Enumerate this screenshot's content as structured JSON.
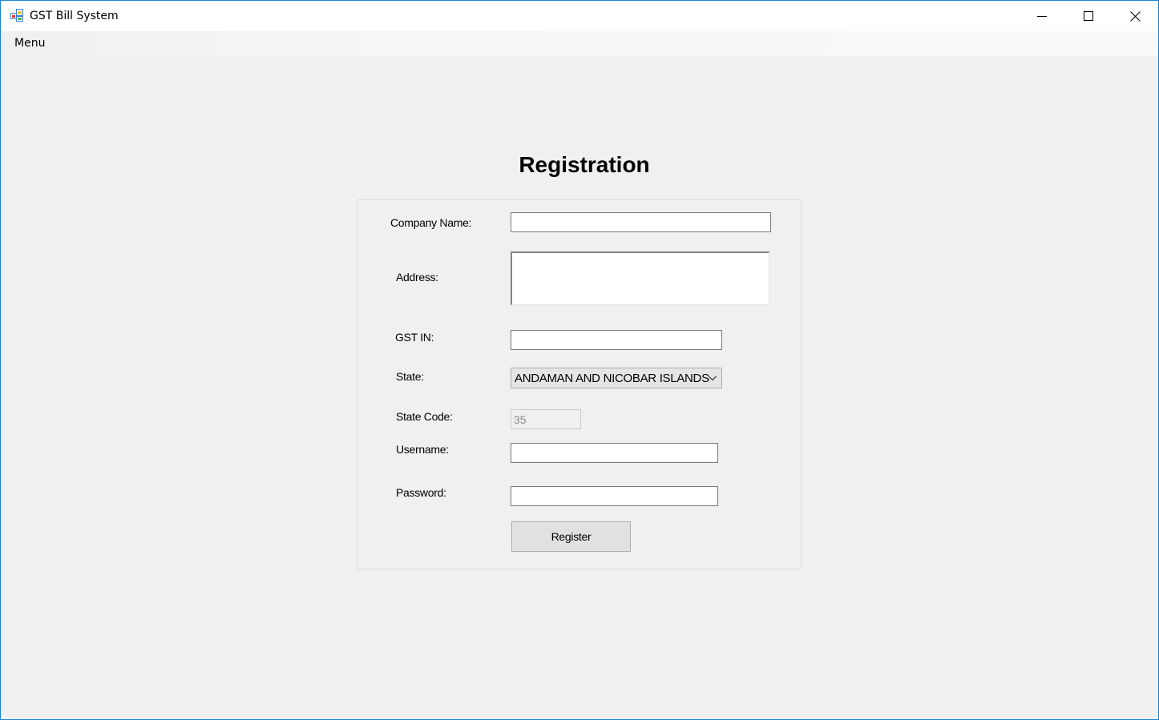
{
  "window": {
    "title": "GST Bill System"
  },
  "menubar": {
    "menu_label": "Menu"
  },
  "form": {
    "title": "Registration",
    "company_name_label": "Company Name:",
    "company_name_value": "",
    "address_label": "Address:",
    "address_value": "",
    "gstin_label": "GST IN:",
    "gstin_value": "",
    "state_label": "State:",
    "state_selected": "ANDAMAN AND NICOBAR ISLANDS",
    "state_code_label": "State Code:",
    "state_code_value": "35",
    "username_label": "Username:",
    "username_value": "",
    "password_label": "Password:",
    "password_value": "",
    "register_label": "Register"
  },
  "icons": {
    "app": "app-window-icon",
    "minimize": "minimize-icon",
    "maximize": "maximize-icon",
    "close": "close-icon",
    "dropdown": "chevron-down-icon"
  },
  "colors": {
    "window_border": "#1883d7",
    "background": "#f0f0f0",
    "button_face": "#e1e1e1"
  }
}
